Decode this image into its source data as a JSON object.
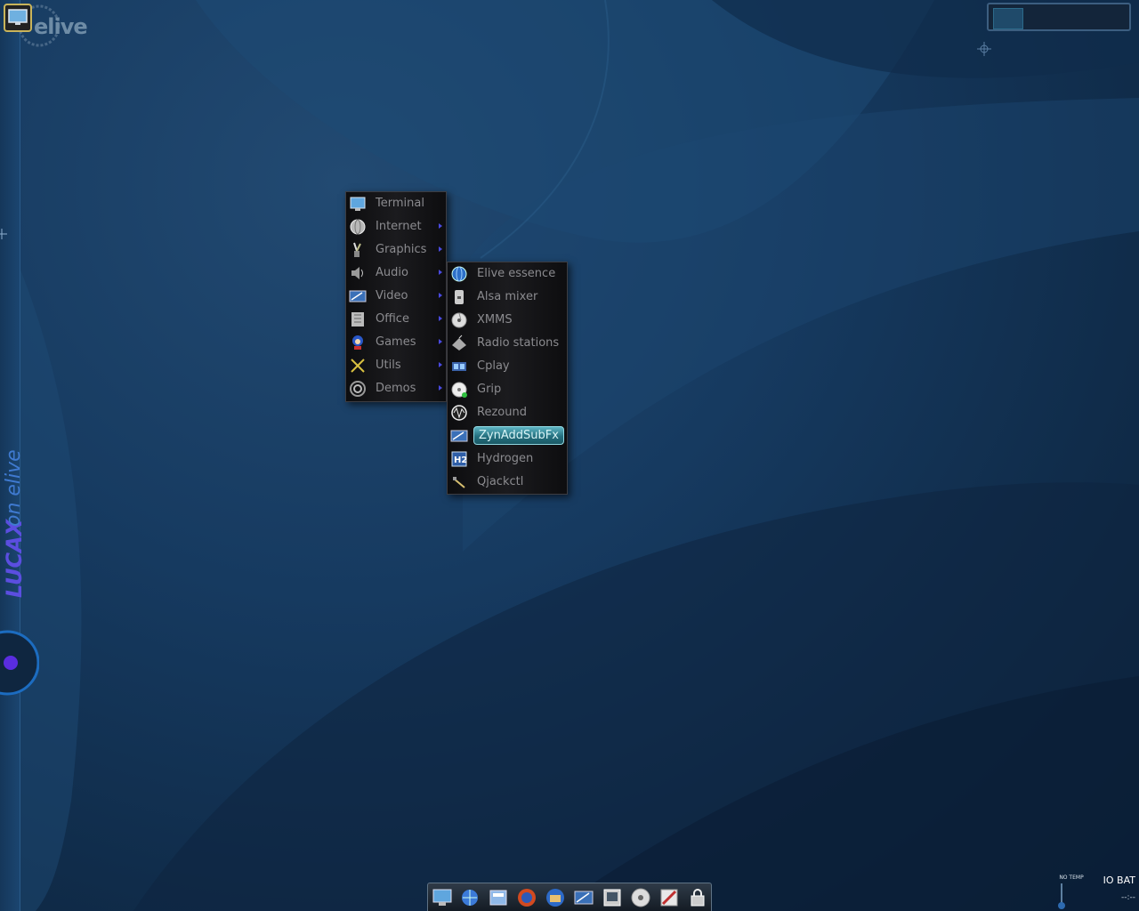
{
  "desktop": {
    "brand": "elive",
    "vertical_brand": "LUCAX on elive"
  },
  "main_menu": {
    "items": [
      {
        "label": "Terminal",
        "icon": "terminal-icon",
        "has_submenu": false
      },
      {
        "label": "Internet",
        "icon": "internet-icon",
        "has_submenu": true
      },
      {
        "label": "Graphics",
        "icon": "graphics-icon",
        "has_submenu": true
      },
      {
        "label": "Audio",
        "icon": "audio-icon",
        "has_submenu": true
      },
      {
        "label": "Video",
        "icon": "video-icon",
        "has_submenu": true
      },
      {
        "label": "Office",
        "icon": "office-icon",
        "has_submenu": true
      },
      {
        "label": "Games",
        "icon": "games-icon",
        "has_submenu": true
      },
      {
        "label": "Utils",
        "icon": "utils-icon",
        "has_submenu": true
      },
      {
        "label": "Demos",
        "icon": "demos-icon",
        "has_submenu": true
      }
    ]
  },
  "audio_submenu": {
    "items": [
      {
        "label": "Elive essence",
        "icon": "globe-icon"
      },
      {
        "label": "Alsa mixer",
        "icon": "mixer-icon"
      },
      {
        "label": "XMMS",
        "icon": "cd-icon"
      },
      {
        "label": "Radio stations",
        "icon": "radio-icon"
      },
      {
        "label": "Cplay",
        "icon": "cplay-icon"
      },
      {
        "label": "Grip",
        "icon": "disc-icon"
      },
      {
        "label": "Rezound",
        "icon": "wave-icon"
      },
      {
        "label": "ZynAddSubFx",
        "icon": "synth-icon",
        "highlighted": true
      },
      {
        "label": "Hydrogen",
        "icon": "hydrogen-icon"
      },
      {
        "label": "Qjackctl",
        "icon": "jack-icon"
      }
    ]
  },
  "dock": {
    "icons": [
      "terminal-icon",
      "network-icon",
      "file-manager-icon",
      "firefox-icon",
      "mail-icon",
      "video-editor-icon",
      "photo-icon",
      "cd-burner-icon",
      "image-editor-icon",
      "lock-icon"
    ]
  },
  "system_tray": {
    "temp_label": "NO TEMP",
    "battery_label": "IO BAT",
    "battery_value": "--:--"
  },
  "colors": {
    "menu_text": "#8b8b8f",
    "highlight": "#3c9aaa",
    "wallpaper": "#163a60"
  }
}
